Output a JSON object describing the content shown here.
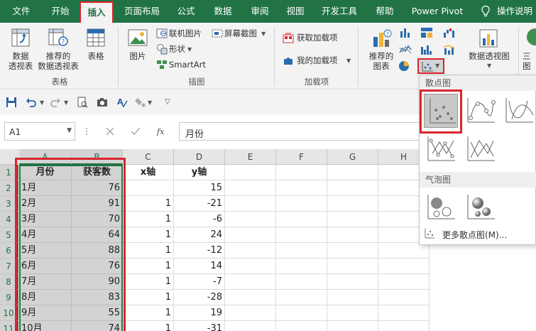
{
  "tabs": [
    "文件",
    "开始",
    "插入",
    "页面布局",
    "公式",
    "数据",
    "审阅",
    "视图",
    "开发工具",
    "帮助",
    "Power Pivot",
    "操作说明"
  ],
  "active_tab": "插入",
  "ribbon": {
    "groups": {
      "tables": "表格",
      "illustrations": "插图",
      "addins": "加载项"
    },
    "buttons": {
      "pivot_table": "数据\n透视表",
      "recommended_pivot": "推荐的\n数据透视表",
      "table": "表格",
      "pictures": "图片",
      "online_pictures": "联机图片",
      "shapes": "形状",
      "smartart": "SmartArt",
      "screenshot": "屏幕截图",
      "get_addins": "获取加载项",
      "my_addins": "我的加载项",
      "recommended_charts": "推荐的\n图表",
      "pivot_chart": "数据透视图",
      "map_3d": "三\n图"
    }
  },
  "namebox": "A1",
  "formula": "月份",
  "columns": [
    "A",
    "B",
    "C",
    "D",
    "E",
    "F",
    "G",
    "H"
  ],
  "rows": [
    "1",
    "2",
    "3",
    "4",
    "5",
    "6",
    "7",
    "8",
    "9",
    "10",
    "11"
  ],
  "sheet": {
    "headers": [
      "月份",
      "获客数",
      "x轴",
      "y轴"
    ],
    "data": [
      [
        "1月",
        "76",
        "",
        "15"
      ],
      [
        "2月",
        "91",
        "1",
        "-21"
      ],
      [
        "3月",
        "70",
        "1",
        "-6"
      ],
      [
        "4月",
        "64",
        "1",
        "24"
      ],
      [
        "5月",
        "88",
        "1",
        "-12"
      ],
      [
        "6月",
        "76",
        "1",
        "14"
      ],
      [
        "7月",
        "90",
        "1",
        "-7"
      ],
      [
        "8月",
        "83",
        "1",
        "-28"
      ],
      [
        "9月",
        "55",
        "1",
        "19"
      ],
      [
        "10月",
        "74",
        "1",
        "-31"
      ]
    ]
  },
  "dropdown": {
    "scatter_title": "散点图",
    "bubble_title": "气泡图",
    "more": "更多散点图(M)..."
  },
  "colors": {
    "excel_green": "#217346",
    "highlight_red": "#d9262e",
    "selection_gray": "#d3d3d3"
  }
}
